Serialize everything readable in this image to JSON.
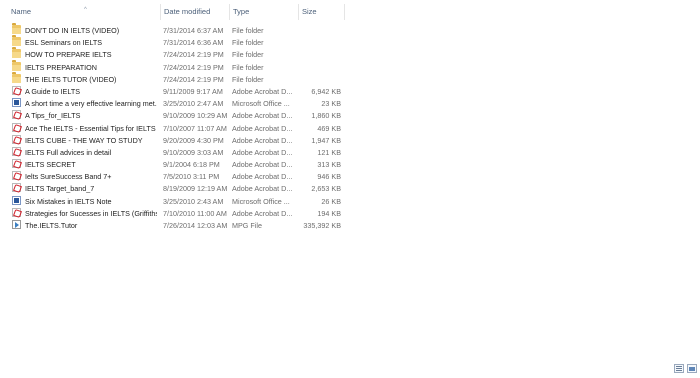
{
  "columns": {
    "name": "Name",
    "date": "Date modified",
    "type": "Type",
    "size": "Size"
  },
  "files": [
    {
      "name": "DON'T DO IN IELTS  (VIDEO)",
      "date": "7/31/2014 6:37 AM",
      "type": "File folder",
      "size": "",
      "icon": "folder-icon"
    },
    {
      "name": "ESL Seminars on IELTS",
      "date": "7/31/2014 6:36 AM",
      "type": "File folder",
      "size": "",
      "icon": "folder-icon"
    },
    {
      "name": "HOW TO PREPARE IELTS",
      "date": "7/24/2014 2:19 PM",
      "type": "File folder",
      "size": "",
      "icon": "folder-icon"
    },
    {
      "name": "IELTS PREPARATION",
      "date": "7/24/2014 2:19 PM",
      "type": "File folder",
      "size": "",
      "icon": "folder-icon"
    },
    {
      "name": "THE IELTS TUTOR (VIDEO)",
      "date": "7/24/2014 2:19 PM",
      "type": "File folder",
      "size": "",
      "icon": "folder-icon"
    },
    {
      "name": "A Guide to IELTS",
      "date": "9/11/2009 9:17 AM",
      "type": "Adobe Acrobat D...",
      "size": "6,942 KB",
      "icon": "pdf-icon"
    },
    {
      "name": "A short time a very effective learning met...",
      "date": "3/25/2010 2:47 AM",
      "type": "Microsoft Office ...",
      "size": "23 KB",
      "icon": "word-doc-icon"
    },
    {
      "name": "A Tips_for_IELTS",
      "date": "9/10/2009 10:29 AM",
      "type": "Adobe Acrobat D...",
      "size": "1,860 KB",
      "icon": "pdf-icon"
    },
    {
      "name": "Ace The IELTS - Essential Tips for IELTS G...",
      "date": "7/10/2007 11:07 AM",
      "type": "Adobe Acrobat D...",
      "size": "469 KB",
      "icon": "pdf-icon"
    },
    {
      "name": "IELTS CUBE - THE WAY TO STUDY",
      "date": "9/20/2009 4:30 PM",
      "type": "Adobe Acrobat D...",
      "size": "1,947 KB",
      "icon": "pdf-icon"
    },
    {
      "name": "IELTS Full advices in detail",
      "date": "9/10/2009 3:03 AM",
      "type": "Adobe Acrobat D...",
      "size": "121 KB",
      "icon": "pdf-icon"
    },
    {
      "name": "IELTS SECRET",
      "date": "9/1/2004 6:18 PM",
      "type": "Adobe Acrobat D...",
      "size": "313 KB",
      "icon": "pdf-icon"
    },
    {
      "name": "Ielts SureSuccess Band 7+",
      "date": "7/5/2010 3:11 PM",
      "type": "Adobe Acrobat D...",
      "size": "946 KB",
      "icon": "pdf-icon"
    },
    {
      "name": "IELTS Target_band_7",
      "date": "8/19/2009 12:19 AM",
      "type": "Adobe Acrobat D...",
      "size": "2,653 KB",
      "icon": "pdf-icon"
    },
    {
      "name": "Six Mistakes in IELTS Note",
      "date": "3/25/2010 2:43 AM",
      "type": "Microsoft Office ...",
      "size": "26 KB",
      "icon": "word-doc-icon"
    },
    {
      "name": "Strategies for Sucesses in IELTS (Griffiths ...",
      "date": "7/10/2010 11:00 AM",
      "type": "Adobe Acrobat D...",
      "size": "194 KB",
      "icon": "pdf-icon"
    },
    {
      "name": "The.IELTS.Tutor",
      "date": "7/26/2014 12:03 AM",
      "type": "MPG File",
      "size": "335,392 KB",
      "icon": "video-file-icon"
    }
  ]
}
